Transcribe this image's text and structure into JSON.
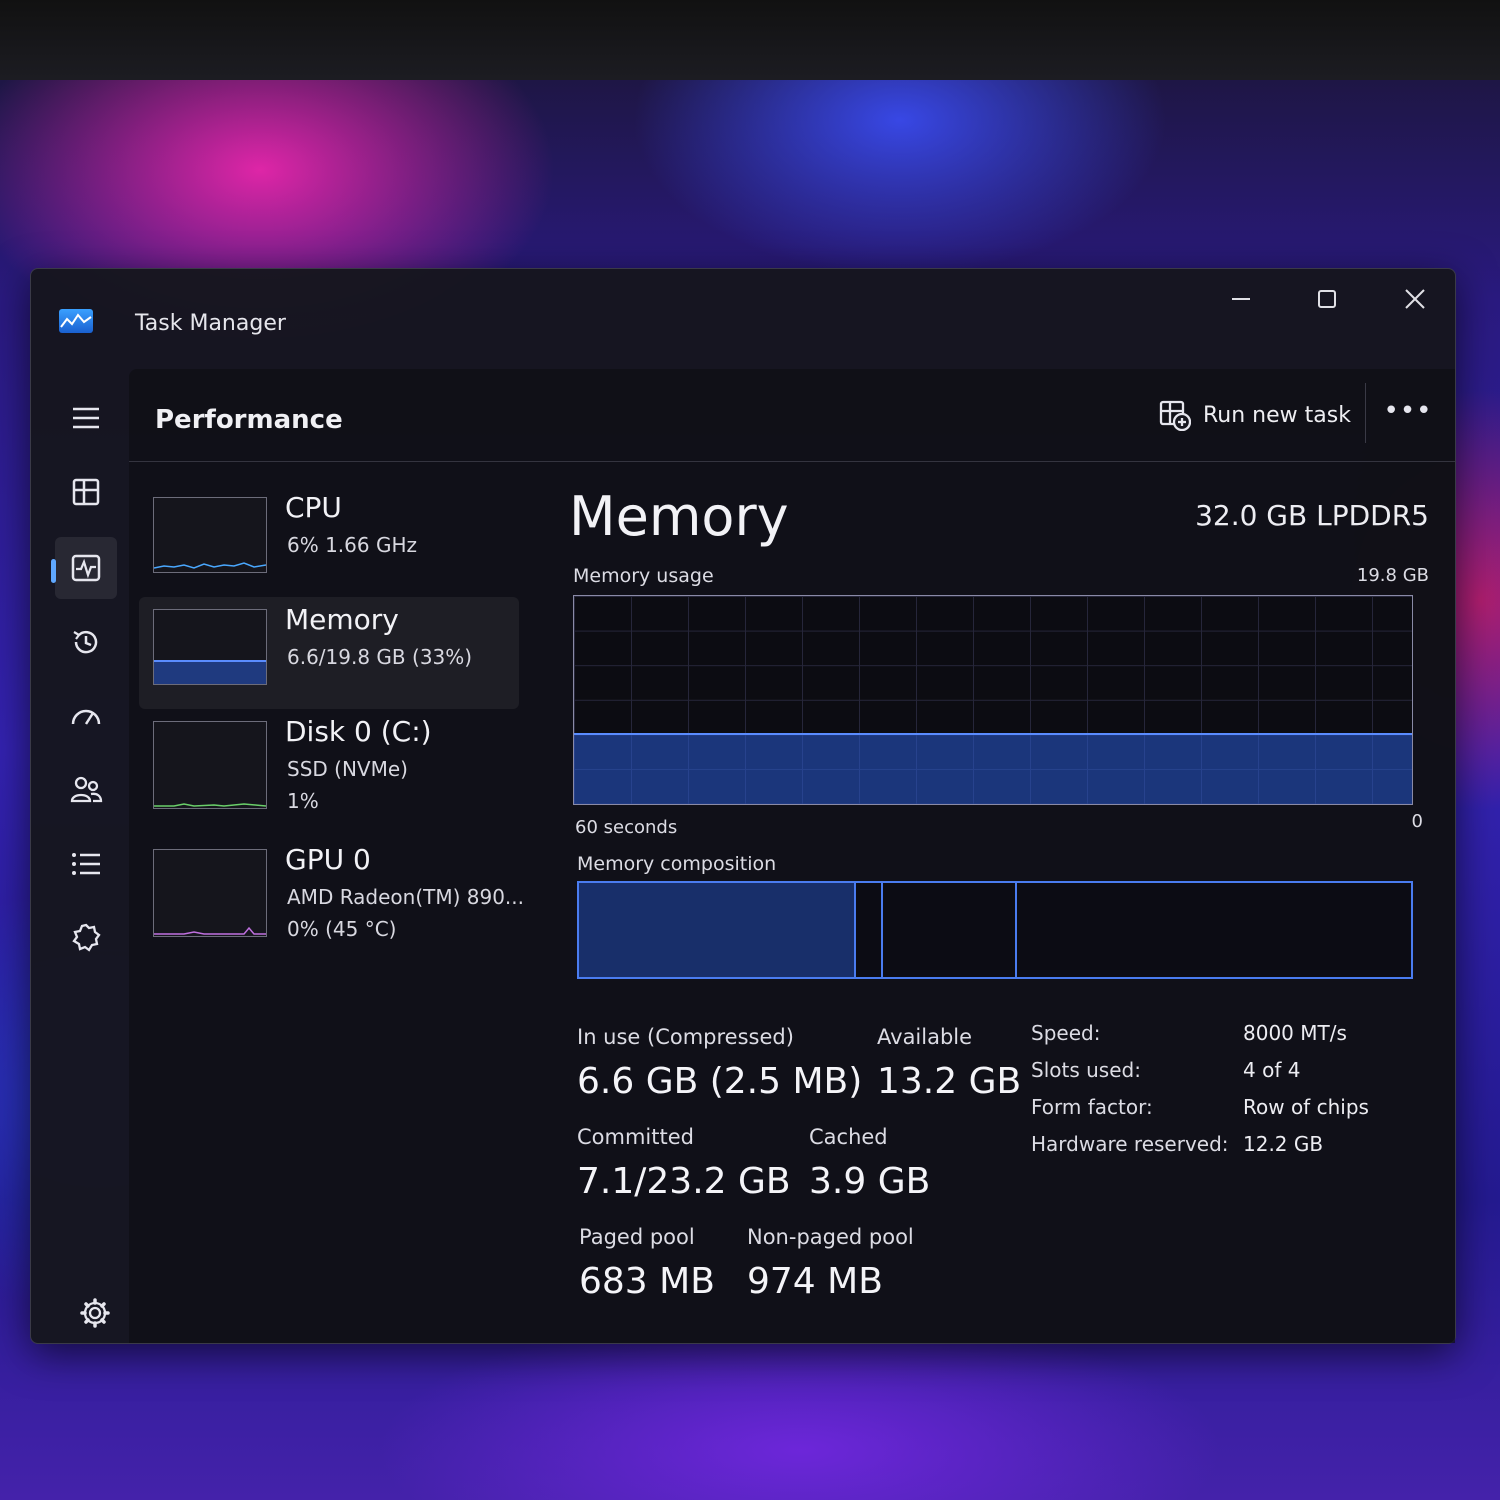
{
  "window": {
    "title": "Task Manager",
    "controls": {
      "minimize": "–",
      "maximize": "☐",
      "close": "✕"
    }
  },
  "nav": {
    "items": [
      {
        "icon": "hamburger-menu-icon"
      },
      {
        "icon": "processes-icon"
      },
      {
        "icon": "performance-icon",
        "active": true
      },
      {
        "icon": "app-history-icon"
      },
      {
        "icon": "startup-apps-icon"
      },
      {
        "icon": "users-icon"
      },
      {
        "icon": "details-icon"
      },
      {
        "icon": "services-icon"
      }
    ],
    "settings_icon": "settings-icon"
  },
  "header": {
    "title": "Performance",
    "run_new_task": "Run new task",
    "more": "•••"
  },
  "devices": [
    {
      "name": "CPU",
      "sub1": "6%  1.66 GHz"
    },
    {
      "name": "Memory",
      "sub1": "6.6/19.8 GB (33%)",
      "selected": true
    },
    {
      "name": "Disk 0 (C:)",
      "sub1": "SSD (NVMe)",
      "sub2": "1%"
    },
    {
      "name": "GPU 0",
      "sub1": "AMD Radeon(TM) 890...",
      "sub2": "0%  (45 °C)"
    }
  ],
  "memory": {
    "title": "Memory",
    "spec": "32.0 GB LPDDR5",
    "usage_label": "Memory usage",
    "usage_max": "19.8 GB",
    "usage_fraction": 0.33,
    "axis_left": "60 seconds",
    "axis_right": "0",
    "composition_label": "Memory composition",
    "composition": [
      0.333,
      0.032,
      0.162,
      0.473
    ],
    "stats": {
      "in_use_label": "In use (Compressed)",
      "in_use_value": "6.6 GB (2.5 MB)",
      "available_label": "Available",
      "available_value": "13.2 GB",
      "committed_label": "Committed",
      "committed_value": "7.1/23.2 GB",
      "cached_label": "Cached",
      "cached_value": "3.9 GB",
      "paged_label": "Paged pool",
      "paged_value": "683 MB",
      "nonpaged_label": "Non-paged pool",
      "nonpaged_value": "974 MB"
    },
    "details": [
      {
        "key": "Speed:",
        "value": "8000 MT/s"
      },
      {
        "key": "Slots used:",
        "value": "4 of 4"
      },
      {
        "key": "Form factor:",
        "value": "Row of chips"
      },
      {
        "key": "Hardware reserved:",
        "value": "12.2 GB"
      }
    ]
  },
  "colors": {
    "accent": "#5fa8ff",
    "graph_line": "#5a8cff",
    "graph_fill": "#2a5ad2"
  }
}
